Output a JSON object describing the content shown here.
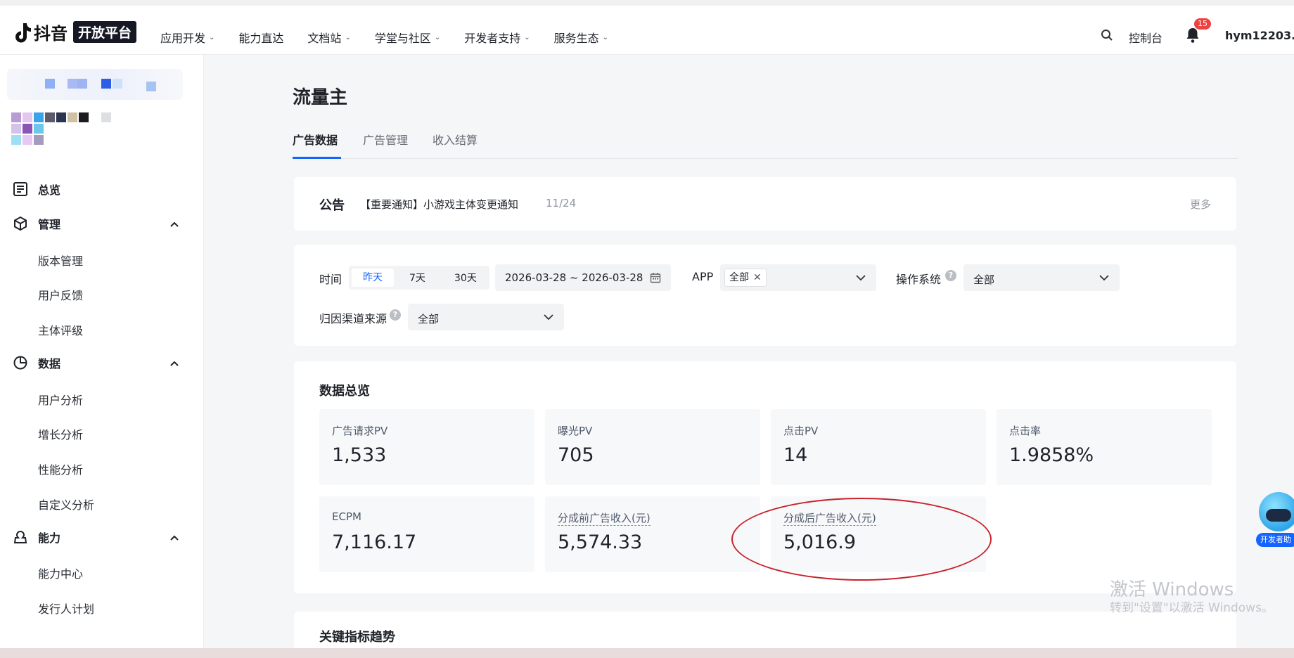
{
  "header": {
    "brand": "抖音",
    "platform": "开放平台",
    "nav": [
      {
        "label": "应用开发",
        "has_caret": true
      },
      {
        "label": "能力直达",
        "has_caret": false
      },
      {
        "label": "文档站",
        "has_caret": true
      },
      {
        "label": "学堂与社区",
        "has_caret": true
      },
      {
        "label": "开发者支持",
        "has_caret": true
      },
      {
        "label": "服务生态",
        "has_caret": true
      }
    ],
    "caret_glyph": "⌄",
    "console": "控制台",
    "notification_count": "15",
    "username": "hym12203..."
  },
  "sidebar": {
    "groups": [
      {
        "label": "总览",
        "icon": "overview-icon"
      },
      {
        "label": "管理",
        "icon": "box-icon",
        "items": [
          "版本管理",
          "用户反馈",
          "主体评级"
        ]
      },
      {
        "label": "数据",
        "icon": "pie-icon",
        "items": [
          "用户分析",
          "增长分析",
          "性能分析",
          "自定义分析"
        ]
      },
      {
        "label": "能力",
        "icon": "ability-icon",
        "items": [
          "能力中心",
          "发行人计划"
        ]
      }
    ]
  },
  "page": {
    "title": "流量主",
    "tabs": [
      "广告数据",
      "广告管理",
      "收入结算"
    ]
  },
  "notice": {
    "label": "公告",
    "text": "【重要通知】小游戏主体变更通知",
    "date": "11/24",
    "more": "更多"
  },
  "filters": {
    "time_label": "时间",
    "time_options": [
      "昨天",
      "7天",
      "30天"
    ],
    "date_range": "2026-03-28 ~ 2026-03-28",
    "app_label": "APP",
    "app_tag": "全部",
    "os_label": "操作系统",
    "os_value": "全部",
    "channel_label": "归因渠道来源",
    "channel_value": "全部"
  },
  "overview": {
    "title": "数据总览",
    "metrics": [
      {
        "label": "广告请求PV",
        "value": "1,533"
      },
      {
        "label": "曝光PV",
        "value": "705"
      },
      {
        "label": "点击PV",
        "value": "14"
      },
      {
        "label": "点击率",
        "value": "1.9858%"
      },
      {
        "label": "ECPM",
        "value": "7,116.17"
      },
      {
        "label": "分成前广告收入(元)",
        "value": "5,574.33"
      },
      {
        "label": "分成后广告收入(元)",
        "value": "5,016.9"
      }
    ]
  },
  "trend": {
    "title": "关键指标趋势"
  },
  "helper": {
    "label": "开发者助"
  },
  "watermark": {
    "line1": "激活 Windows",
    "line2": "转到\"设置\"以激活 Windows。"
  },
  "colors": {
    "accent": "#1664ff",
    "badge": "#f04142",
    "annotation": "#c8232c"
  }
}
